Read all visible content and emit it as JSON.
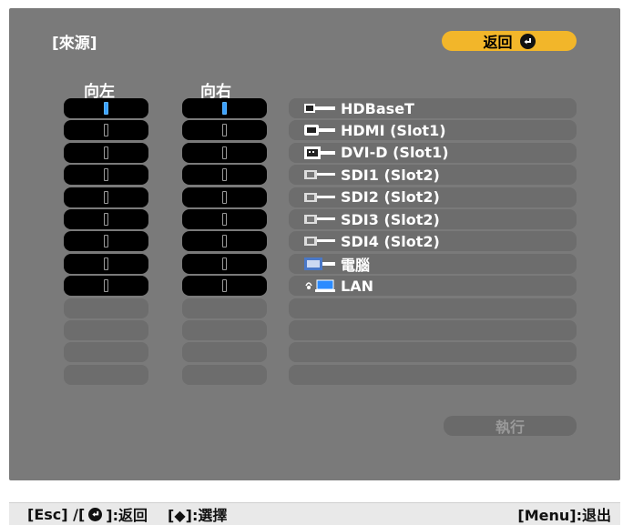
{
  "screen": {
    "title": "[來源]",
    "back_label": "返回",
    "col_left": "向左",
    "col_right": "向右",
    "execute_label": "執行"
  },
  "sources": [
    {
      "label": "HDBaseT",
      "icon": "hdbaset-connector-icon",
      "selected_left": true,
      "selected_right": true
    },
    {
      "label": "HDMI (Slot1)",
      "icon": "hdmi-connector-icon",
      "selected_left": false,
      "selected_right": false
    },
    {
      "label": "DVI-D (Slot1)",
      "icon": "dvi-connector-icon",
      "selected_left": false,
      "selected_right": false
    },
    {
      "label": "SDI1 (Slot2)",
      "icon": "sdi-connector-icon",
      "selected_left": false,
      "selected_right": false
    },
    {
      "label": "SDI2 (Slot2)",
      "icon": "sdi-connector-icon",
      "selected_left": false,
      "selected_right": false
    },
    {
      "label": "SDI3 (Slot2)",
      "icon": "sdi-connector-icon",
      "selected_left": false,
      "selected_right": false
    },
    {
      "label": "SDI4 (Slot2)",
      "icon": "sdi-connector-icon",
      "selected_left": false,
      "selected_right": false
    },
    {
      "label": "電腦",
      "icon": "computer-vga-icon",
      "selected_left": false,
      "selected_right": false
    },
    {
      "label": "LAN",
      "icon": "lan-wireless-icon",
      "selected_left": false,
      "selected_right": false
    }
  ],
  "bottom_bar": {
    "help_esc": "[Esc] /[",
    "help_return": "]:返回",
    "help_select": "[◆]:選擇",
    "help_menu": "[Menu]:退出"
  },
  "colors": {
    "panel": "#7a7a7a",
    "accent": "#f2b62a",
    "selected_slot": "#3aa0ff"
  }
}
